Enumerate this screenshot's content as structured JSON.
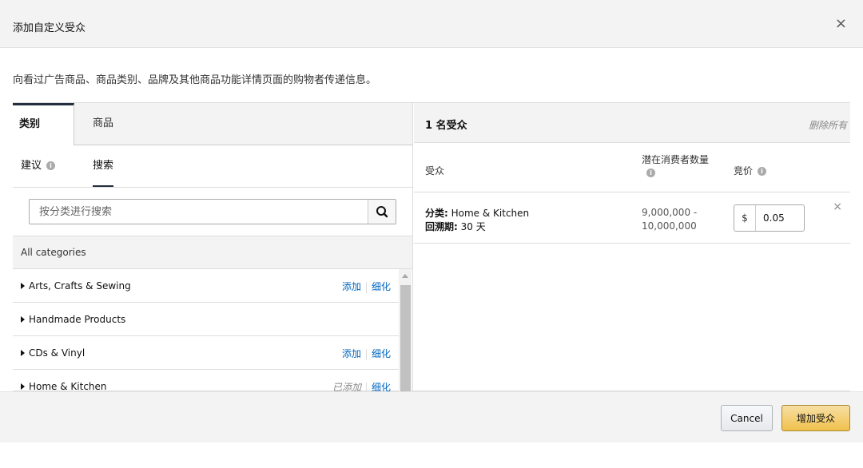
{
  "dialog": {
    "title": "添加自定义受众",
    "close_glyph": "×",
    "description": "向看过广告商品、商品类别、品牌及其他商品功能详情页面的购物者传递信息。"
  },
  "left_panel": {
    "tabs": [
      {
        "label": "类别",
        "active": true
      },
      {
        "label": "商品",
        "active": false
      }
    ],
    "subtabs": [
      {
        "label": "建议",
        "active": false
      },
      {
        "label": "搜索",
        "active": true
      }
    ],
    "search": {
      "placeholder": "按分类进行搜索",
      "value": ""
    },
    "all_categories_label": "All categories",
    "categories": [
      {
        "name": "Arts, Crafts & Sewing",
        "add_label": "添加",
        "refine_label": "细化",
        "status": "available"
      },
      {
        "name": "Handmade Products",
        "add_label": "",
        "refine_label": "",
        "status": "none"
      },
      {
        "name": "CDs & Vinyl",
        "add_label": "添加",
        "refine_label": "细化",
        "status": "available"
      },
      {
        "name": "Home & Kitchen",
        "add_label": "已添加",
        "refine_label": "细化",
        "status": "added"
      }
    ]
  },
  "right_panel": {
    "count_label": "1 名受众",
    "remove_all_label": "删除所有",
    "columns": {
      "audience": "受众",
      "reach": "潜在消费者数量",
      "bid": "竞价"
    },
    "rows": [
      {
        "category_label": "分类:",
        "category_value": " Home & Kitchen",
        "lookback_label": "回溯期:",
        "lookback_value": " 30 天",
        "reach_line1": "9,000,000 -",
        "reach_line2": "10,000,000",
        "currency": "$",
        "bid": "0.05",
        "remove_glyph": "×"
      }
    ]
  },
  "footer": {
    "cancel_label": "Cancel",
    "add_label": "增加受众"
  },
  "colors": {
    "primary_button": "#f0c14b",
    "link": "#0066c0",
    "header_bg": "#f3f3f3",
    "active_tab_border": "#232f3e"
  },
  "icons": [
    "close-icon",
    "info-icon",
    "search-icon",
    "caret-right-icon",
    "scroll-up-icon"
  ]
}
